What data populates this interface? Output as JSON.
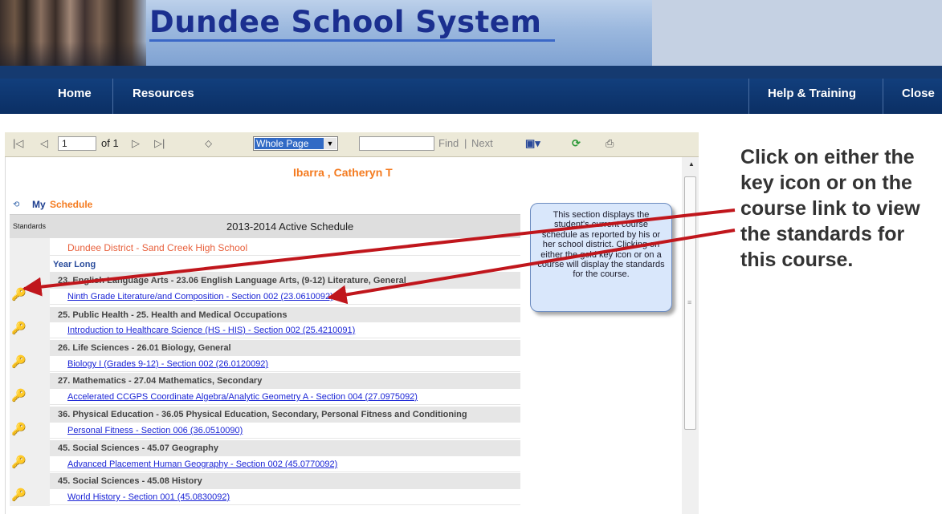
{
  "header": {
    "title": "Dundee School System",
    "nav": {
      "home": "Home",
      "resources": "Resources",
      "help": "Help & Training",
      "close": "Close"
    }
  },
  "toolbar": {
    "page": "1",
    "of_label": "of 1",
    "zoom": "Whole Page",
    "find": "Find",
    "separator": "|",
    "next": "Next"
  },
  "report": {
    "student_name": "Ibarra , Catheryn  T",
    "my_label": "My",
    "schedule_label": "Schedule",
    "standards_label": "Standards",
    "schedule_title": "2013-2014 Active Schedule",
    "district": "Dundee District - Sand Creek High School",
    "term": "Year Long",
    "subjects": [
      "23. English Language Arts - 23.06 English Language Arts, (9-12) Literature, General",
      "25. Public Health - 25. Health and Medical Occupations",
      "26. Life Sciences - 26.01 Biology, General",
      "27. Mathematics - 27.04 Mathematics, Secondary",
      "36. Physical Education - 36.05 Physical Education, Secondary, Personal Fitness and Conditioning",
      "45. Social Sciences - 45.07 Geography",
      "45. Social Sciences - 45.08 History"
    ],
    "courses": [
      "Ninth Grade Literature/and Composition  - Section 002 (23.0610092)",
      "Introduction to Healthcare Science (HS - HIS) - Section 002 (25.4210091)",
      "Biology I (Grades 9-12)  - Section 002 (26.0120092)",
      "Accelerated CCGPS Coordinate Algebra/Analytic Geometry A - Section 004 (27.0975092)",
      "Personal Fitness  - Section 006 (36.0510090)",
      "Advanced Placement Human Geography  - Section 002 (45.0770092)",
      "World History  - Section 001 (45.0830092)"
    ]
  },
  "callout": "This section displays the student's current course schedule as reported by his or her school district. Clicking on either the gold key icon or on a course will display the standards for the course.",
  "annotation": "Click on either the key icon or on the course link to view the standards for this course.",
  "colors": {
    "brand_blue": "#1b2f8f",
    "nav_blue": "#0b2f64",
    "accent_orange": "#f47b20",
    "link_blue": "#1a24d6",
    "arrow_red": "#c0161c"
  },
  "icons": [
    "key-icon",
    "first-page-icon",
    "prev-page-icon",
    "next-page-icon",
    "last-page-icon",
    "back-icon",
    "export-icon",
    "refresh-icon",
    "print-icon"
  ]
}
